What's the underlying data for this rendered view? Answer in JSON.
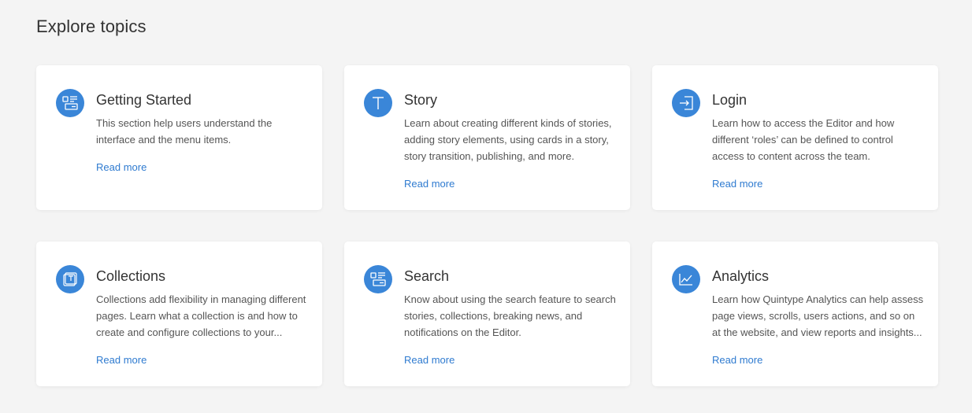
{
  "heading": "Explore topics",
  "accent_color": "#3a86d8",
  "link_color": "#2f7bd0",
  "cards": [
    {
      "title": "Getting Started",
      "icon": "layout-icon",
      "description": "This section help users understand the interface and the menu items.",
      "link": "Read more"
    },
    {
      "title": "Story",
      "icon": "text-t-icon",
      "description": "Learn about creating different kinds of stories, adding story elements, using cards in a story, story transition, publishing, and more.",
      "link": "Read more"
    },
    {
      "title": "Login",
      "icon": "login-icon",
      "description": "Learn how to access the Editor and how different ‘roles’ can be defined to control access to content across the team.",
      "link": "Read more"
    },
    {
      "title": "Collections",
      "icon": "collection-icon",
      "description": "Collections add flexibility in managing different pages. Learn what a collection is and how to create and configure collections to your...",
      "link": "Read more"
    },
    {
      "title": "Search",
      "icon": "layout-icon",
      "description": "Know about using the search feature to search stories, collections, breaking news, and notifications on the Editor.",
      "link": "Read more"
    },
    {
      "title": "Analytics",
      "icon": "chart-line-icon",
      "description": "Learn how Quintype Analytics can help assess page views, scrolls, users actions, and so on at the website, and view reports and insights...",
      "link": "Read more"
    }
  ]
}
